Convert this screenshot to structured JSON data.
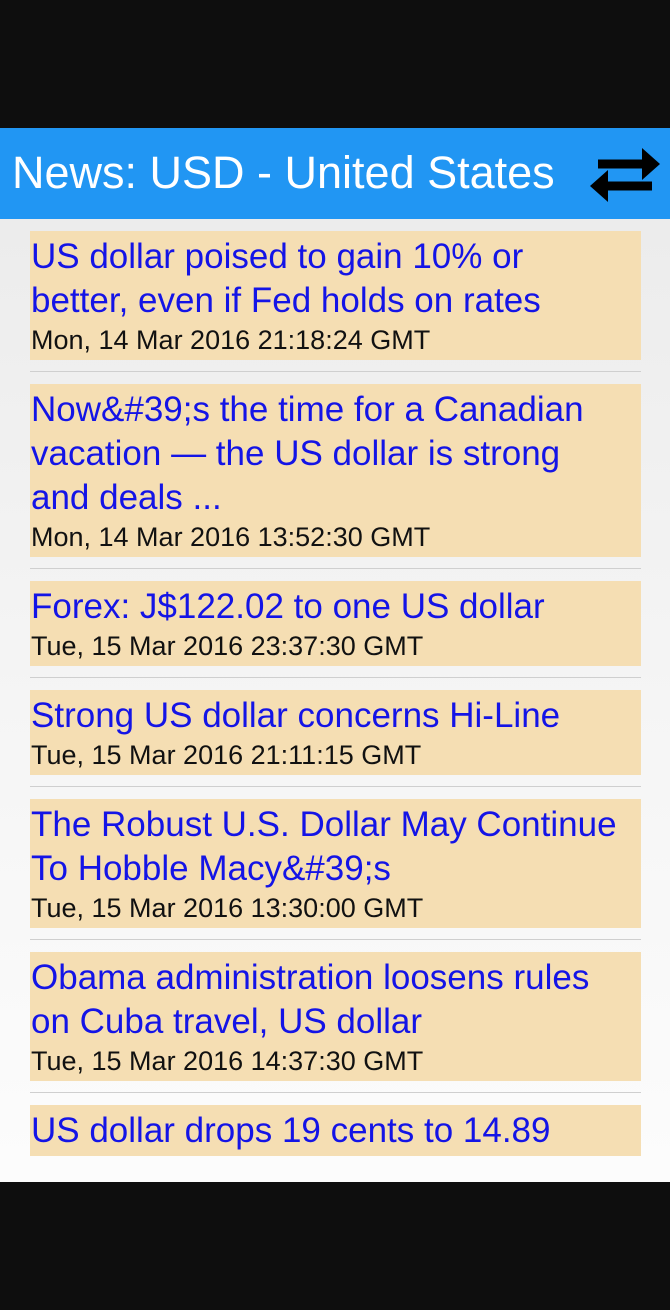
{
  "header": {
    "title": "News: USD - United States",
    "swap_icon": "swap-arrows-icon"
  },
  "colors": {
    "app_bar": "#2196f3",
    "item_background": "#f5deb3",
    "headline": "#1414e6"
  },
  "news": [
    {
      "headline": "US dollar poised to gain 10% or\nbetter, even if Fed holds on rates",
      "date": "Mon, 14 Mar 2016 21:18:24 GMT"
    },
    {
      "headline": "Now&#39;s the time for a Canadian\nvacation — the US dollar is strong\nand deals ...",
      "date": "Mon, 14 Mar 2016 13:52:30 GMT"
    },
    {
      "headline": "Forex: J$122.02 to one US dollar",
      "date": "Tue, 15 Mar 2016 23:37:30 GMT"
    },
    {
      "headline": "Strong US dollar concerns Hi-Line",
      "date": "Tue, 15 Mar 2016 21:11:15 GMT"
    },
    {
      "headline": "The Robust U.S. Dollar May Continue\nTo Hobble Macy&#39;s",
      "date": "Tue, 15 Mar 2016 13:30:00 GMT"
    },
    {
      "headline": "Obama administration loosens rules\non Cuba travel, US dollar",
      "date": "Tue, 15 Mar 2016 14:37:30 GMT"
    },
    {
      "headline": "US dollar drops 19 cents to 14.89",
      "date": ""
    }
  ]
}
